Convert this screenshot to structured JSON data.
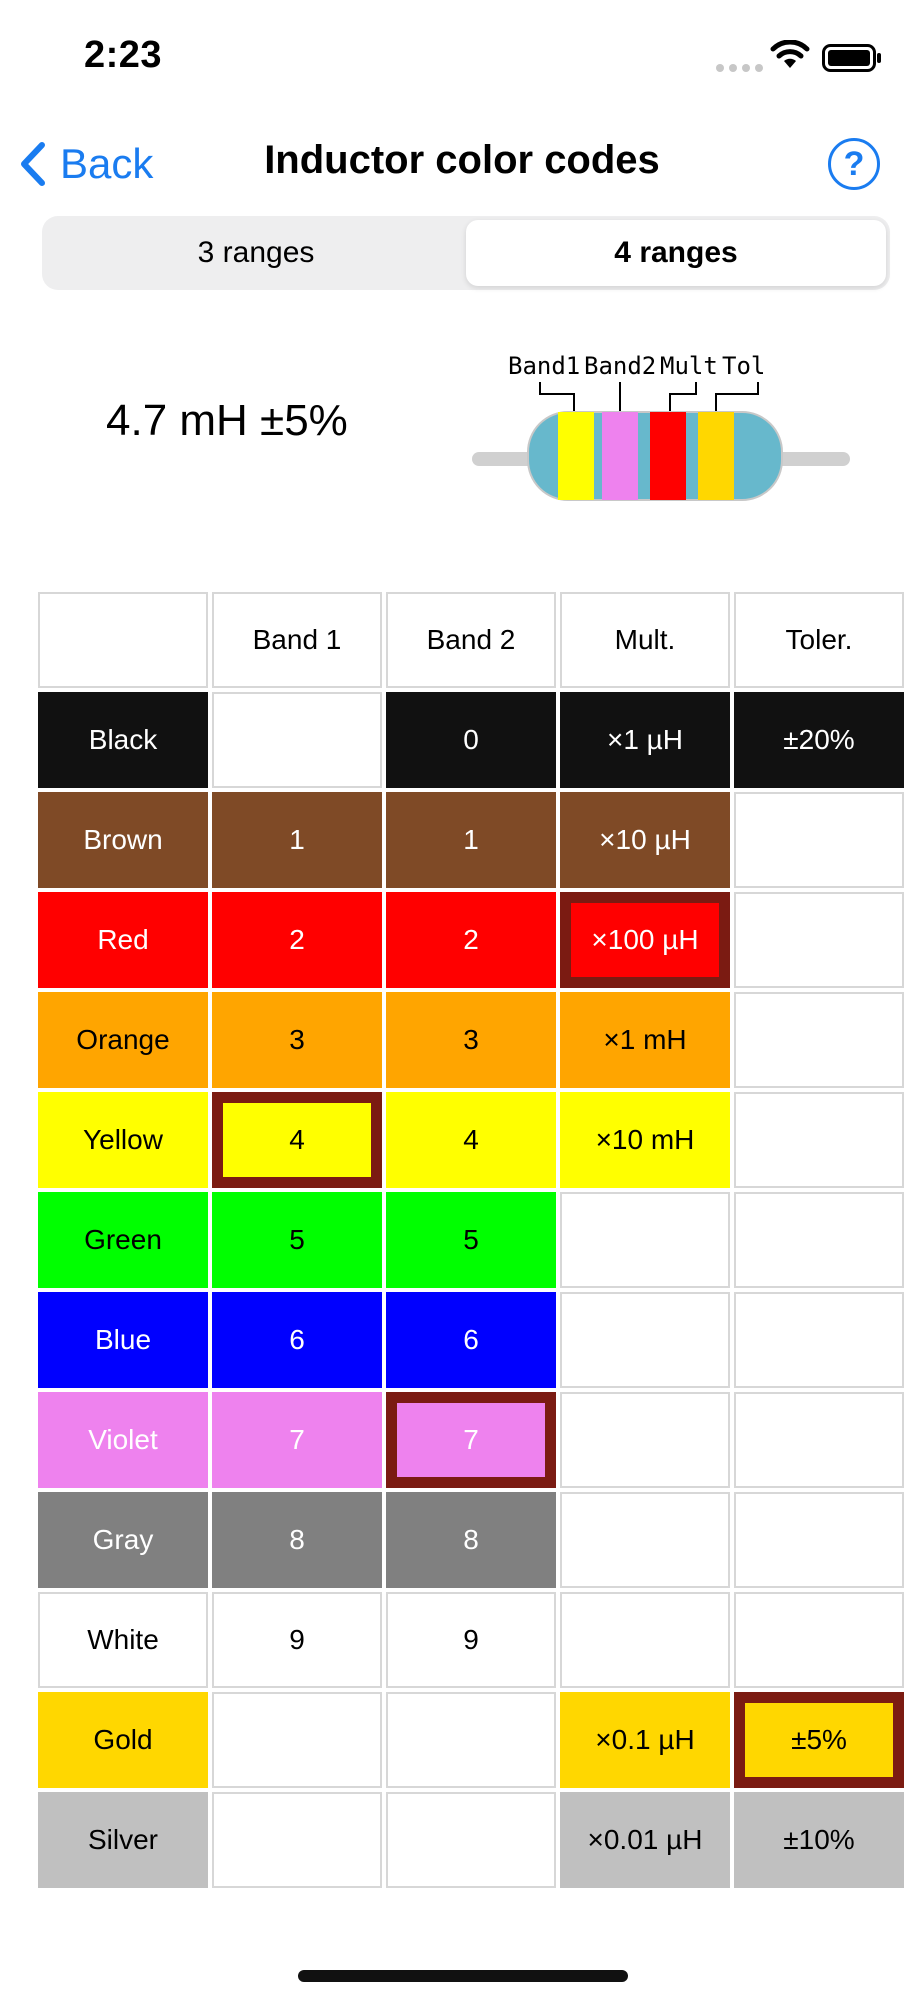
{
  "status_bar": {
    "time": "2:23"
  },
  "nav": {
    "back_label": "Back",
    "title": "Inductor color codes",
    "help_label": "?"
  },
  "segmented": {
    "options": [
      "3 ranges",
      "4 ranges"
    ],
    "selected": "4 ranges"
  },
  "value_display": "4.7 mH ±5%",
  "diagram": {
    "labels": [
      "Band1",
      "Band2",
      "Mult",
      "Tol"
    ],
    "band_colors": [
      "#ffff00",
      "#ee82ee",
      "#ff0000",
      "#ffd700"
    ],
    "body_color": "#67b8cc"
  },
  "table": {
    "headers": [
      "",
      "Band 1",
      "Band 2",
      "Mult.",
      "Toler."
    ],
    "rows": [
      {
        "name": "Black",
        "bg": "#111111",
        "fg": "#ffffff",
        "band1": "",
        "band2": "0",
        "mult": "×1 µH",
        "tol": "±20%"
      },
      {
        "name": "Brown",
        "bg": "#7f4a26",
        "fg": "#ffffff",
        "band1": "1",
        "band2": "1",
        "mult": "×10 µH",
        "tol": ""
      },
      {
        "name": "Red",
        "bg": "#ff0000",
        "fg": "#ffffff",
        "band1": "2",
        "band2": "2",
        "mult": "×100 µH",
        "tol": ""
      },
      {
        "name": "Orange",
        "bg": "#ffa500",
        "fg": "#000000",
        "band1": "3",
        "band2": "3",
        "mult": "×1 mH",
        "tol": ""
      },
      {
        "name": "Yellow",
        "bg": "#ffff00",
        "fg": "#000000",
        "band1": "4",
        "band2": "4",
        "mult": "×10 mH",
        "tol": ""
      },
      {
        "name": "Green",
        "bg": "#00ff00",
        "fg": "#000000",
        "band1": "5",
        "band2": "5",
        "mult": "",
        "tol": ""
      },
      {
        "name": "Blue",
        "bg": "#0000ff",
        "fg": "#ffffff",
        "band1": "6",
        "band2": "6",
        "mult": "",
        "tol": ""
      },
      {
        "name": "Violet",
        "bg": "#ee82ee",
        "fg": "#ffffff",
        "band1": "7",
        "band2": "7",
        "mult": "",
        "tol": ""
      },
      {
        "name": "Gray",
        "bg": "#808080",
        "fg": "#ffffff",
        "band1": "8",
        "band2": "8",
        "mult": "",
        "tol": ""
      },
      {
        "name": "White",
        "bg": "#ffffff",
        "fg": "#000000",
        "band1": "9",
        "band2": "9",
        "mult": "",
        "tol": ""
      },
      {
        "name": "Gold",
        "bg": "#ffd700",
        "fg": "#000000",
        "band1": "",
        "band2": "",
        "mult": "×0.1 µH",
        "tol": "±5%"
      },
      {
        "name": "Silver",
        "bg": "#c0c0c0",
        "fg": "#000000",
        "band1": "",
        "band2": "",
        "mult": "×0.01 µH",
        "tol": "±10%"
      }
    ],
    "selected": {
      "band1": "Yellow",
      "band2": "Violet",
      "mult": "Red",
      "tol": "Gold"
    }
  }
}
